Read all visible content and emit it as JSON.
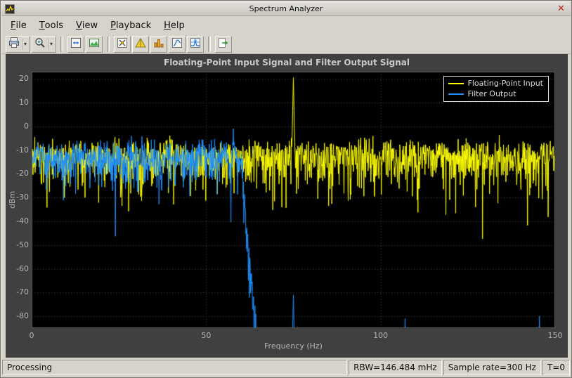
{
  "window": {
    "title": "Spectrum Analyzer",
    "close_label": "✕"
  },
  "menu": {
    "items": [
      {
        "label": "File"
      },
      {
        "label": "Tools"
      },
      {
        "label": "View"
      },
      {
        "label": "Playback"
      },
      {
        "label": "Help"
      }
    ]
  },
  "toolbar": {
    "items": [
      {
        "name": "print",
        "icon": "printer-icon",
        "dropdown": true
      },
      {
        "name": "zoom",
        "icon": "magnifier-icon",
        "dropdown": true
      },
      {
        "sep": true
      },
      {
        "name": "fit-to-view",
        "icon": "fit-to-view-icon"
      },
      {
        "name": "spectrum-settings",
        "icon": "spectrum-settings-icon"
      },
      {
        "sep": true
      },
      {
        "name": "cursor-measurements",
        "icon": "cursor-measurements-icon"
      },
      {
        "name": "peak-finder",
        "icon": "peak-finder-icon"
      },
      {
        "name": "distortion-measurements",
        "icon": "distortion-measurements-icon"
      },
      {
        "name": "ccdf-measurements",
        "icon": "ccdf-measurements-icon"
      },
      {
        "name": "spectral-mask",
        "icon": "spectral-mask-icon"
      },
      {
        "sep": true
      },
      {
        "name": "playback-export",
        "icon": "export-icon"
      }
    ]
  },
  "status_bar": {
    "processing": "Processing",
    "rbw": "RBW=146.484 mHz",
    "sample_rate": "Sample rate=300 Hz",
    "time": "T=0"
  },
  "chart_data": {
    "type": "line",
    "title": "Floating-Point Input Signal and Filter Output Signal",
    "xlabel": "Frequency (Hz)",
    "ylabel": "dBm",
    "xlim": [
      0,
      150
    ],
    "ylim": [
      -85,
      23
    ],
    "xticks": [
      0,
      50,
      100,
      150
    ],
    "yticks": [
      20,
      10,
      0,
      -10,
      -20,
      -30,
      -40,
      -50,
      -60,
      -70,
      -80
    ],
    "grid": true,
    "legend_position": "top-right",
    "plot_bg": "#000000",
    "figure_bg": "#404040",
    "grid_color": "#4f4f4f",
    "tick_color": "#b4b4b4",
    "series": [
      {
        "name": "Floating-Point Input",
        "color": "#ffff00",
        "description": "Broadband noise floor around -13 dBm spanning 0-150 Hz, excursions roughly -8 to -45 dBm, with a narrow tone peak reaching +20 dBm at 75 Hz",
        "noise_floor_dbm": -12,
        "peaks": [
          {
            "freq_hz": 75,
            "level_dbm": 20.5
          }
        ]
      },
      {
        "name": "Filter Output",
        "color": "#1e90ff",
        "description": "Lowpass-filtered noise: passband near -13 dBm up to ~60 Hz, steep rolloff 60-65 Hz falling below -85 dBm, stopband floor below axis with leakage spikes",
        "noise_floor_dbm": -12,
        "passband_edge_hz": 60,
        "stopband_start_hz": 64.8,
        "stopband_floor_dbm": -97,
        "peaks": [
          {
            "freq_hz": 57.8,
            "level_dbm": -1
          },
          {
            "freq_hz": 75,
            "level_dbm": -71
          },
          {
            "freq_hz": 107,
            "level_dbm": -81
          },
          {
            "freq_hz": 145.5,
            "level_dbm": -80
          },
          {
            "freq_hz": 150,
            "level_dbm": -78
          }
        ]
      }
    ]
  }
}
